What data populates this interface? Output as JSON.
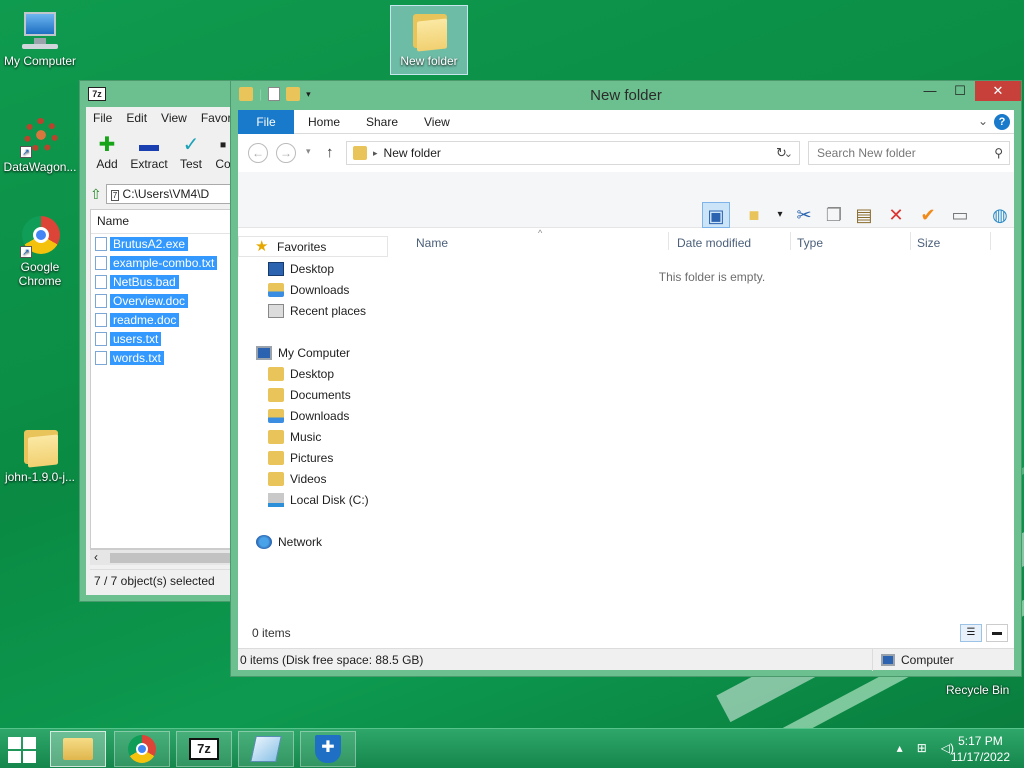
{
  "desktop": {
    "icons": [
      {
        "label": "My Computer"
      },
      {
        "label": "New folder"
      },
      {
        "label": "DataWagon..."
      },
      {
        "label": "Google Chrome"
      },
      {
        "label": "john-1.9.0-j..."
      }
    ],
    "recycle_bin": "Recycle Bin"
  },
  "sevenzip": {
    "logo": "7z",
    "menu": [
      "File",
      "Edit",
      "View",
      "Favori"
    ],
    "tools": [
      {
        "label": "Add",
        "icon": "plus-icon"
      },
      {
        "label": "Extract",
        "icon": "minus-icon"
      },
      {
        "label": "Test",
        "icon": "check-icon"
      },
      {
        "label": "Co",
        "icon": "copy-icon"
      }
    ],
    "address": "C:\\Users\\VM4\\D",
    "column_name": "Name",
    "files": [
      "BrutusA2.exe",
      "example-combo.txt",
      "NetBus.bad",
      "Overview.doc",
      "readme.doc",
      "users.txt",
      "words.txt"
    ],
    "status": "7 / 7 object(s) selected"
  },
  "explorer": {
    "title": "New folder",
    "ribbon_tabs": [
      "File",
      "Home",
      "Share",
      "View"
    ],
    "help": "?",
    "address": "New folder",
    "search_placeholder": "Search New folder",
    "nav": {
      "favorites": "Favorites",
      "fav_items": [
        "Desktop",
        "Downloads",
        "Recent places"
      ],
      "computer": "My Computer",
      "comp_items": [
        "Desktop",
        "Documents",
        "Downloads",
        "Music",
        "Pictures",
        "Videos",
        "Local Disk (C:)"
      ],
      "network": "Network"
    },
    "columns": [
      "Name",
      "Date modified",
      "Type",
      "Size"
    ],
    "empty_message": "This folder is empty.",
    "item_count": "0 items",
    "status_left": "0 items (Disk free space: 88.5 GB)",
    "status_right": "Computer"
  },
  "taskbar": {
    "time": "5:17 PM",
    "date": "11/17/2022"
  }
}
